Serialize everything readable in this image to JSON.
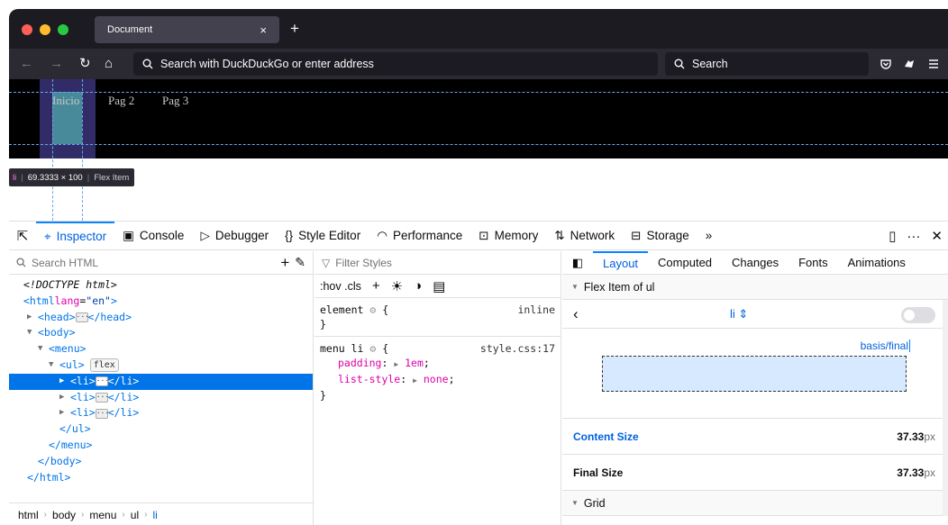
{
  "browser": {
    "tab_title": "Document",
    "tab_close": "×",
    "new_tab": "+",
    "url_placeholder": "Search with DuckDuckGo or enter address",
    "search_placeholder": "Search"
  },
  "page": {
    "menu_items": [
      "Inicio",
      "Pag 2",
      "Pag 3"
    ],
    "infobar": {
      "tag": "li",
      "dims": "69.3333 × 100",
      "type": "Flex Item"
    }
  },
  "devtools": {
    "tabs": [
      "Inspector",
      "Console",
      "Debugger",
      "Style Editor",
      "Performance",
      "Memory",
      "Network",
      "Storage"
    ],
    "overflow": "»",
    "markup": {
      "search_placeholder": "Search HTML",
      "doctype": "<!DOCTYPE html>",
      "html_open": "<html",
      "lang_attr": "lang",
      "lang_val": "\"en\"",
      "gt": ">",
      "head": "<head>",
      "head_close": "</head>",
      "body": "<body>",
      "menu": "<menu>",
      "ul": "<ul>",
      "flex_badge": "flex",
      "li": "<li>",
      "li_close": "</li>",
      "ul_close": "</ul>",
      "menu_close": "</menu>",
      "body_close": "</body>",
      "html_close": "</html>",
      "breadcrumb": [
        "html",
        "body",
        "menu",
        "ul",
        "li"
      ]
    },
    "rules": {
      "filter_placeholder": "Filter Styles",
      "hov_cls": ":hov .cls",
      "element_selector": "element",
      "element_src": "inline",
      "open_brace": "{",
      "close_brace": "}",
      "rule_selector": "menu li",
      "rule_src": "style.css:17",
      "props": [
        {
          "name": "padding",
          "value": "1em"
        },
        {
          "name": "list-style",
          "value": "none"
        }
      ]
    },
    "layout": {
      "tabs": [
        "Layout",
        "Computed",
        "Changes",
        "Fonts",
        "Animations"
      ],
      "flex_section": "Flex Item of ul",
      "item_selector": "li",
      "basis_label": "basis/final",
      "content_size_label": "Content Size",
      "content_size_value": "37.33",
      "final_size_label": "Final Size",
      "final_size_value": "37.33",
      "unit": "px",
      "grid_section": "Grid"
    }
  }
}
